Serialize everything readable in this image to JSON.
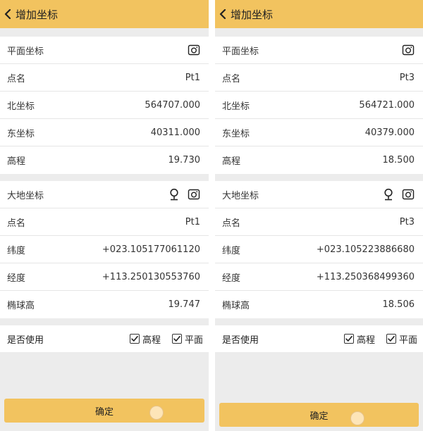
{
  "screens": [
    {
      "title": "增加坐标",
      "plane": {
        "header": "平面坐标",
        "rows": [
          {
            "label": "点名",
            "value": "Pt1"
          },
          {
            "label": "北坐标",
            "value": "564707.000"
          },
          {
            "label": "东坐标",
            "value": "40311.000"
          },
          {
            "label": "高程",
            "value": "19.730"
          }
        ]
      },
      "geodetic": {
        "header": "大地坐标",
        "rows": [
          {
            "label": "点名",
            "value": "Pt1"
          },
          {
            "label": "纬度",
            "value": "+023.105177061120"
          },
          {
            "label": "经度",
            "value": "+113.250130553760"
          },
          {
            "label": "椭球高",
            "value": "19.747"
          }
        ]
      },
      "usage": {
        "label": "是否使用",
        "elevation": "高程",
        "plane": "平面"
      },
      "confirm": "确定"
    },
    {
      "title": "增加坐标",
      "plane": {
        "header": "平面坐标",
        "rows": [
          {
            "label": "点名",
            "value": "Pt3"
          },
          {
            "label": "北坐标",
            "value": "564721.000"
          },
          {
            "label": "东坐标",
            "value": "40379.000"
          },
          {
            "label": "高程",
            "value": "18.500"
          }
        ]
      },
      "geodetic": {
        "header": "大地坐标",
        "rows": [
          {
            "label": "点名",
            "value": "Pt3"
          },
          {
            "label": "纬度",
            "value": "+023.105223886680"
          },
          {
            "label": "经度",
            "value": "+113.250368499360"
          },
          {
            "label": "椭球高",
            "value": "18.506"
          }
        ]
      },
      "usage": {
        "label": "是否使用",
        "elevation": "高程",
        "plane": "平面"
      },
      "confirm": "确定"
    }
  ],
  "colors": {
    "accent": "#f2c35f",
    "background": "#ececec"
  },
  "icons": {
    "back": "chevron-left-icon",
    "camera": "camera-icon",
    "location": "location-pin-icon",
    "check": "checkbox-checked-icon"
  }
}
